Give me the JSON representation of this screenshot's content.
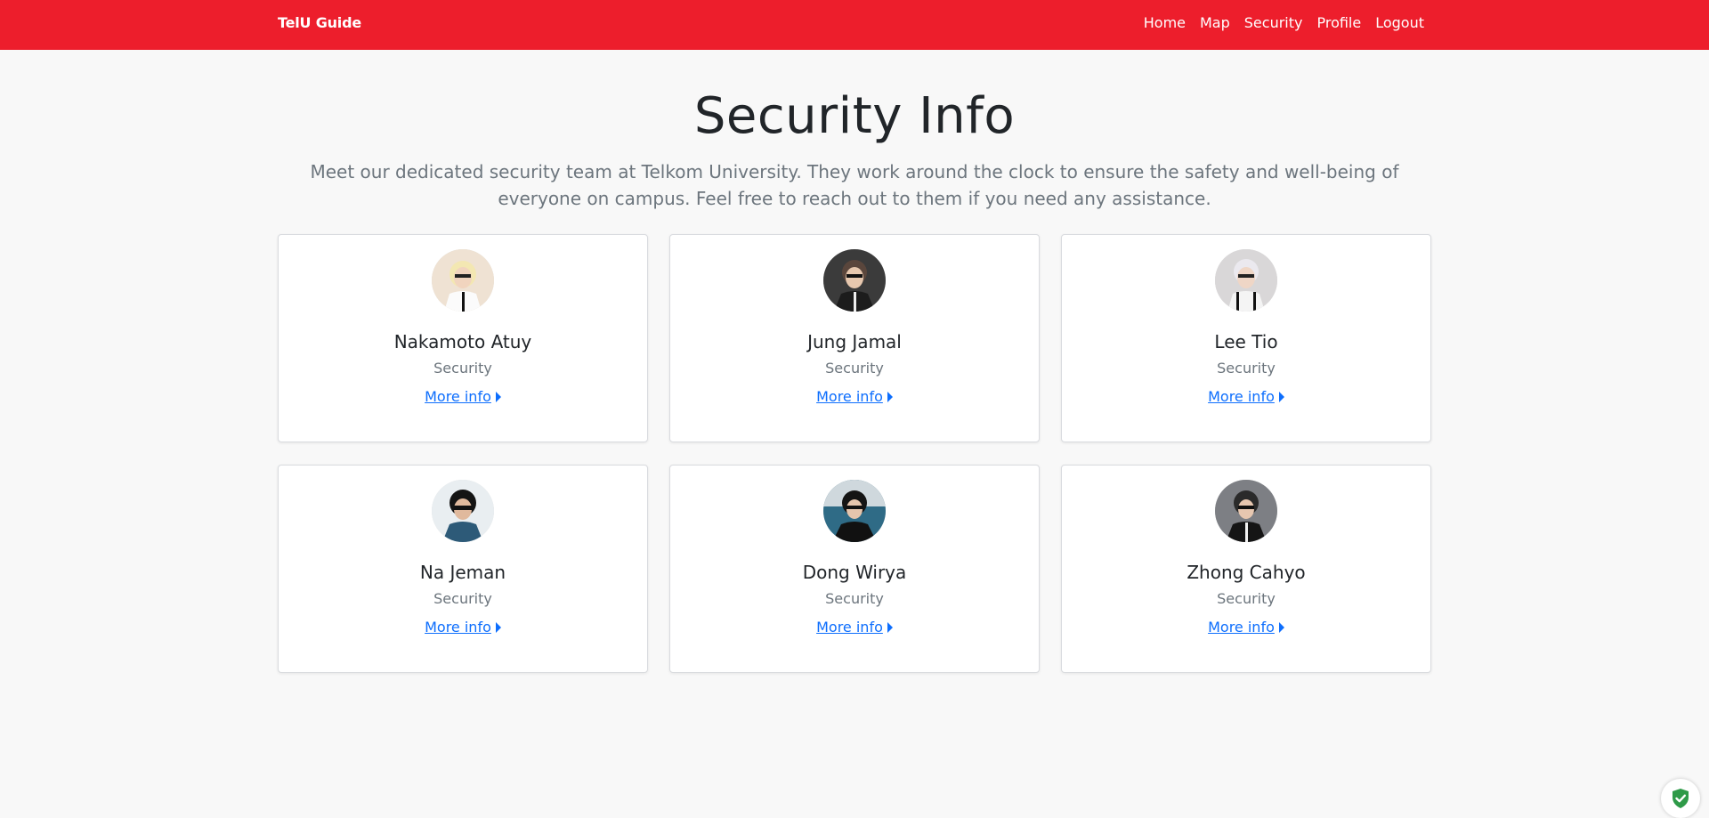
{
  "navbar": {
    "brand": "TelU Guide",
    "links": [
      "Home",
      "Map",
      "Security",
      "Profile",
      "Logout"
    ],
    "background": "#ed1e2c"
  },
  "header": {
    "title": "Security Info",
    "subtitle": "Meet our dedicated security team at Telkom University. They work around the clock to ensure the safety and well-being of everyone on campus. Feel free to reach out to them if you need any assistance."
  },
  "cards": [
    {
      "name": "Nakamoto Atuy",
      "role": "Security",
      "link": "More info",
      "avatar": "person-photo-icon"
    },
    {
      "name": "Jung Jamal",
      "role": "Security",
      "link": "More info",
      "avatar": "person-photo-icon"
    },
    {
      "name": "Lee Tio",
      "role": "Security",
      "link": "More info",
      "avatar": "person-photo-icon"
    },
    {
      "name": "Na Jeman",
      "role": "Security",
      "link": "More info",
      "avatar": "person-photo-icon"
    },
    {
      "name": "Dong Wirya",
      "role": "Security",
      "link": "More info",
      "avatar": "person-photo-icon"
    },
    {
      "name": "Zhong Cahyo",
      "role": "Security",
      "link": "More info",
      "avatar": "person-photo-icon"
    }
  ],
  "colors": {
    "link": "#0d6efd",
    "muted": "#6c757d",
    "accent_shield": "#2e9a48"
  },
  "corner_icon": "shield-check-icon"
}
